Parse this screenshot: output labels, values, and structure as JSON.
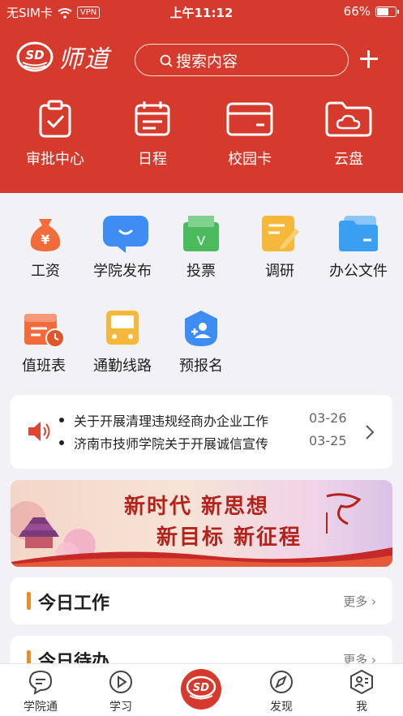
{
  "status_bar": {
    "carrier": "无SIM卡",
    "vpn": "VPN",
    "time": "上午11:12",
    "battery": "66%",
    "battery_level": 0.66
  },
  "header": {
    "app_name": "师道",
    "logo_badge": "SD",
    "search_placeholder": "搜索内容",
    "quick_actions": [
      {
        "label": "审批中心",
        "icon": "clipboard-check-icon"
      },
      {
        "label": "日程",
        "icon": "calendar-icon"
      },
      {
        "label": "校园卡",
        "icon": "card-icon"
      },
      {
        "label": "云盘",
        "icon": "cloud-folder-icon"
      }
    ]
  },
  "grid": [
    {
      "label": "工资",
      "icon": "money-bag-icon",
      "color": "#f26b3a"
    },
    {
      "label": "学院发布",
      "icon": "chat-bubble-icon",
      "color": "#3d8df5"
    },
    {
      "label": "投票",
      "icon": "vote-box-icon",
      "color": "#4cbb5f"
    },
    {
      "label": "调研",
      "icon": "survey-icon",
      "color": "#f5b83a"
    },
    {
      "label": "办公文件",
      "icon": "folder-icon",
      "color": "#3a9ff0"
    },
    {
      "label": "值班表",
      "icon": "duty-calendar-icon",
      "color": "#f26b3a"
    },
    {
      "label": "通勤线路",
      "icon": "bus-icon",
      "color": "#f5b83a"
    },
    {
      "label": "预报名",
      "icon": "enroll-icon",
      "color": "#3d8df5"
    }
  ],
  "notices": [
    {
      "text": "关于开展清理违规经商办企业工作",
      "date": "03-26"
    },
    {
      "text": "济南市技师学院关于开展诚信宣传",
      "date": "03-25"
    }
  ],
  "banner": {
    "line1": "新时代 新思想",
    "line2": "新目标 新征程"
  },
  "sections": [
    {
      "title": "今日工作",
      "more": "更多"
    },
    {
      "title": "今日待办",
      "more": "更多"
    }
  ],
  "tabs": [
    {
      "label": "学院通",
      "icon": "chat-icon"
    },
    {
      "label": "学习",
      "icon": "play-icon"
    },
    {
      "label": "",
      "icon": "sd-logo-icon"
    },
    {
      "label": "发现",
      "icon": "compass-icon"
    },
    {
      "label": "我",
      "icon": "profile-icon"
    }
  ],
  "colors": {
    "brand_red": "#d63a2c",
    "accent_orange": "#f08a24",
    "background": "#f2f2f6"
  }
}
